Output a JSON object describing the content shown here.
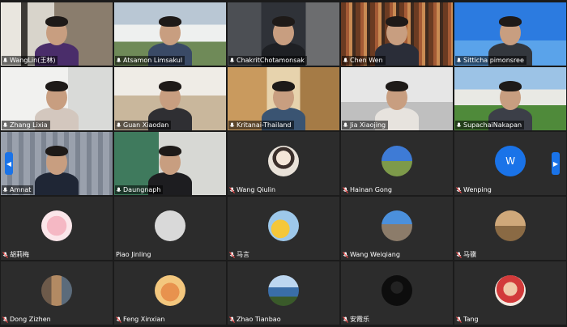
{
  "app": {
    "accent_color": "#1a73e8",
    "prev_page_icon": "chevron-left-icon",
    "next_page_icon": "chevron-right-icon"
  },
  "participants": [
    {
      "name": "WangLin(王林)",
      "type": "video",
      "scene": "office-shelves",
      "mic_icon": "microphone-icon"
    },
    {
      "name": "Atsamon Limsakul",
      "type": "video",
      "scene": "campus-building",
      "mic_icon": "microphone-icon"
    },
    {
      "name": "ChakritChotamonsak",
      "type": "video",
      "scene": "dark-room",
      "mic_icon": "microphone-icon"
    },
    {
      "name": "Chen Wen",
      "type": "video",
      "scene": "bookshelf",
      "mic_icon": "microphone-icon"
    },
    {
      "name": "Sitticha pimonsree",
      "type": "video",
      "scene": "blue-sky",
      "mic_icon": "microphone-icon"
    },
    {
      "name": "Zhang Lixia",
      "type": "video",
      "scene": "bright-room",
      "mic_icon": "microphone-icon"
    },
    {
      "name": "Guan Xiaodan",
      "type": "video",
      "scene": "shelf-room",
      "mic_icon": "microphone-icon"
    },
    {
      "name": "Kritanai-Thailand",
      "type": "video",
      "scene": "warm-shelves",
      "mic_icon": "microphone-icon"
    },
    {
      "name": "Jia Xiaojing",
      "type": "video",
      "scene": "white-office",
      "mic_icon": "microphone-icon"
    },
    {
      "name": "SupachaiNakapan",
      "type": "video",
      "scene": "campus-garden",
      "mic_icon": "microphone-icon"
    },
    {
      "name": "Amnat",
      "type": "video",
      "scene": "curtain",
      "mic_icon": "microphone-icon"
    },
    {
      "name": "Daungnaph",
      "type": "video",
      "scene": "green-wall",
      "mic_icon": "microphone-icon"
    },
    {
      "name": "Wang Qiulin",
      "type": "avatar",
      "avatar_kind": "cartoon-girl-icon",
      "mic_icon": "microphone-muted-icon"
    },
    {
      "name": "Hainan Gong",
      "type": "avatar",
      "avatar_kind": "landscape-photo-icon",
      "mic_icon": "microphone-muted-icon"
    },
    {
      "name": "Wenping",
      "type": "avatar",
      "avatar_kind": "letter",
      "avatar_letter": "W",
      "mic_icon": "microphone-muted-icon"
    },
    {
      "name": "胡莉梅",
      "type": "avatar",
      "avatar_kind": "pink-bear-icon",
      "mic_icon": "microphone-muted-icon"
    },
    {
      "name": "Piao Jinling",
      "type": "avatar",
      "avatar_kind": "blank-gray-icon",
      "mic_icon": ""
    },
    {
      "name": "马言",
      "type": "avatar",
      "avatar_kind": "sun-yellow-icon",
      "mic_icon": "microphone-muted-icon"
    },
    {
      "name": "Wang Weiqiang",
      "type": "avatar",
      "avatar_kind": "mountain-photo-icon",
      "mic_icon": "microphone-muted-icon"
    },
    {
      "name": "马骥",
      "type": "avatar",
      "avatar_kind": "field-photo-icon",
      "mic_icon": "microphone-muted-icon"
    },
    {
      "name": "Dong Zizhen",
      "type": "avatar",
      "avatar_kind": "street-photo-icon",
      "mic_icon": "microphone-muted-icon"
    },
    {
      "name": "Feng Xinxian",
      "type": "avatar",
      "avatar_kind": "cartoon-face-icon",
      "mic_icon": "microphone-muted-icon"
    },
    {
      "name": "Zhao Tianbao",
      "type": "avatar",
      "avatar_kind": "lake-photo-icon",
      "mic_icon": "microphone-muted-icon"
    },
    {
      "name": "安霞乐",
      "type": "avatar",
      "avatar_kind": "dark-figure-icon",
      "mic_icon": "microphone-muted-icon"
    },
    {
      "name": "Tang",
      "type": "avatar",
      "avatar_kind": "portrait-photo-icon",
      "mic_icon": "microphone-muted-icon"
    }
  ]
}
